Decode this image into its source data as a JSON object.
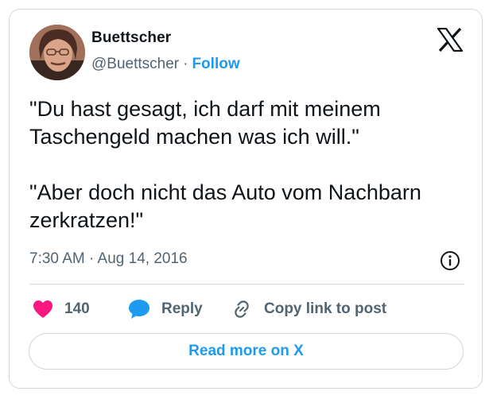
{
  "author": {
    "name": "Buettscher",
    "handle": "@Buettscher",
    "separator": "·",
    "follow_label": "Follow"
  },
  "tweet": {
    "paragraphs": [
      "\"Du hast gesagt, ich darf mit meinem Taschengeld machen was ich will.\"",
      "\"Aber doch nicht das Auto vom Nachbarn zerkratzen!\""
    ],
    "timestamp": "7:30 AM · Aug 14, 2016"
  },
  "actions": {
    "like_count": "140",
    "reply_label": "Reply",
    "copy_label": "Copy link to post"
  },
  "read_more_label": "Read more on X",
  "colors": {
    "accent": "#1d9bf0",
    "like": "#f91880",
    "text": "#0f1419",
    "muted": "#536471",
    "border": "#cfd9de"
  },
  "icons": {
    "platform_logo": "x-logo-icon",
    "info": "info-icon",
    "like": "heart-icon",
    "reply": "speech-bubble-icon",
    "copy": "link-icon"
  }
}
